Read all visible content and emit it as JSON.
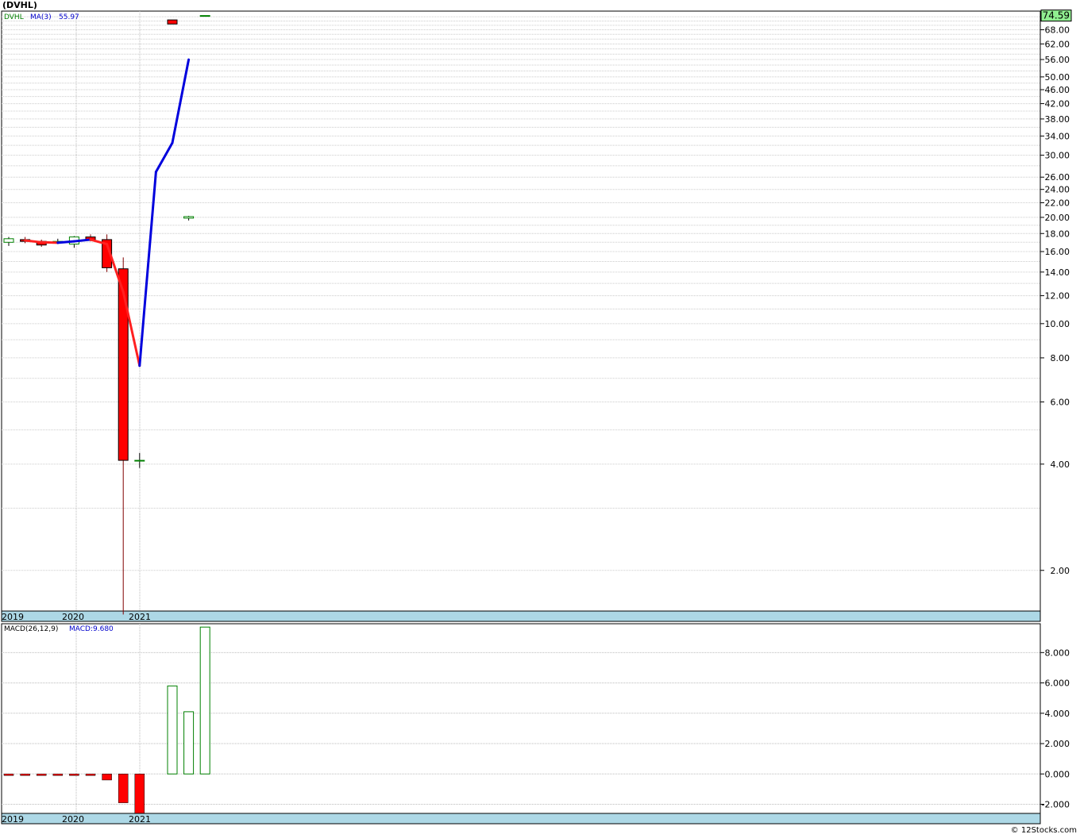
{
  "title": "(DVHL)",
  "footer": "© 12Stocks.com",
  "colors": {
    "up": "#008000",
    "down": "#ff0000",
    "ma_up": "#0000dd",
    "ma_down": "#ff2020",
    "grid": "#b0b0b0",
    "axis_band": "#add8e6",
    "last_price_bg": "#90ee90"
  },
  "chart_data": [
    {
      "type": "candlestick",
      "symbol": "DVHL",
      "scale": "log",
      "ylim": [
        1.55,
        76
      ],
      "yticks": [
        "74.00",
        "68.00",
        "62.00",
        "56.00",
        "50.00",
        "46.00",
        "42.00",
        "38.00",
        "34.00",
        "30.00",
        "26.00",
        "24.00",
        "22.00",
        "20.00",
        "18.00",
        "16.00",
        "14.00",
        "12.00",
        "10.00",
        "8.00",
        "6.00",
        "4.00",
        "2.00"
      ],
      "last_price": "74.59",
      "legend": {
        "symbol": "DVHL",
        "ma_label": "MA(3)",
        "ma_value": "55.97"
      },
      "xlabels": [
        "2019",
        "2020",
        "2021"
      ],
      "grid": true,
      "candles": [
        {
          "o": 17.0,
          "h": 17.6,
          "l": 16.6,
          "c": 17.4
        },
        {
          "o": 17.3,
          "h": 17.6,
          "l": 16.9,
          "c": 17.1
        },
        {
          "o": 17.1,
          "h": 17.3,
          "l": 16.5,
          "c": 16.7
        },
        {
          "o": 17.0,
          "h": 17.4,
          "l": 16.8,
          "c": 17.1
        },
        {
          "o": 16.8,
          "h": 17.7,
          "l": 16.4,
          "c": 17.6
        },
        {
          "o": 17.6,
          "h": 17.9,
          "l": 17.1,
          "c": 17.2
        },
        {
          "o": 17.3,
          "h": 17.9,
          "l": 14.0,
          "c": 14.4
        },
        {
          "o": 14.3,
          "h": 15.4,
          "l": 1.5,
          "c": 4.1
        },
        {
          "o": 4.1,
          "h": 4.3,
          "l": 3.9,
          "c": 4.1
        },
        {
          "o": null,
          "h": null,
          "l": null,
          "c": null
        },
        {
          "o": 72.5,
          "h": 72.5,
          "l": 70.6,
          "c": 70.6
        },
        {
          "o": 19.9,
          "h": 20.2,
          "l": 19.6,
          "c": 20.1
        },
        {
          "o": 74.6,
          "h": 74.6,
          "l": 74.6,
          "c": 74.6
        }
      ],
      "ma": [
        null,
        17.2,
        17.0,
        16.95,
        17.1,
        17.3,
        16.8,
        12.3,
        7.6,
        26.9,
        32.5,
        55.97
      ]
    },
    {
      "type": "bar",
      "indicator": "MACD(26,12,9)",
      "legend": {
        "label": "MACD(26,12,9)",
        "value_label": "MACD:9.680"
      },
      "ylim": [
        -2.6,
        9.9
      ],
      "yticks": [
        "8.000",
        "6.000",
        "4.000",
        "2.000",
        "0.000",
        "-2.000"
      ],
      "xlabels": [
        "2019",
        "2020",
        "2021"
      ],
      "values": [
        -0.1,
        -0.1,
        -0.1,
        -0.1,
        -0.05,
        -0.05,
        -0.4,
        -1.9,
        -3.0,
        null,
        5.8,
        4.1,
        9.68
      ]
    }
  ]
}
